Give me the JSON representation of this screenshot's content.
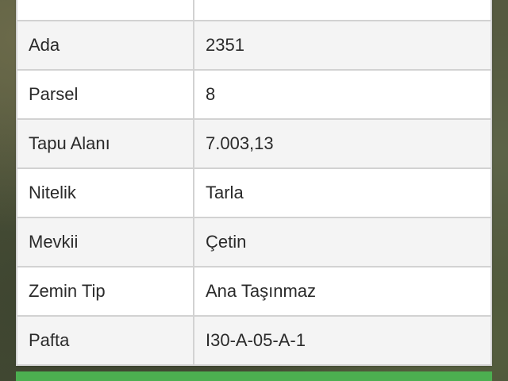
{
  "parcel_info": {
    "rows": [
      {
        "label": "",
        "value": ""
      },
      {
        "label": "Ada",
        "value": "2351"
      },
      {
        "label": "Parsel",
        "value": "8"
      },
      {
        "label": "Tapu Alanı",
        "value": "7.003,13"
      },
      {
        "label": "Nitelik",
        "value": "Tarla"
      },
      {
        "label": "Mevkii",
        "value": "Çetin"
      },
      {
        "label": "Zemin Tip",
        "value": "Ana Taşınmaz"
      },
      {
        "label": "Pafta",
        "value": "I30-A-05-A-1"
      }
    ]
  },
  "colors": {
    "accent_green": "#4caf50",
    "border": "#d2d2d2",
    "row_alt": "#f4f4f4"
  }
}
